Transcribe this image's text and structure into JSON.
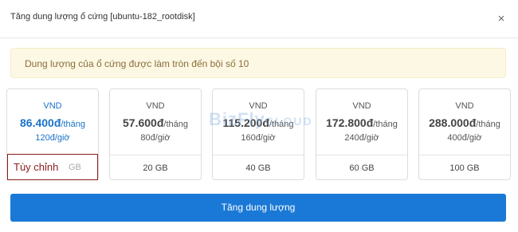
{
  "modal": {
    "title": "Tăng dung lượng ổ cứng [ubuntu-182_rootdisk]",
    "close_glyph": "×",
    "notice": "Dung lượng của ổ cứng được làm tròn đến bội số 10",
    "submit_label": "Tăng dung lượng"
  },
  "currency": "VND",
  "plans": [
    {
      "currency": "VND",
      "price": "86.400đ",
      "unit": "/tháng",
      "hourly": "120đ/giờ",
      "size": "",
      "active": true
    },
    {
      "currency": "VND",
      "price": "57.600đ",
      "unit": "/tháng",
      "hourly": "80đ/giờ",
      "size": "20 GB",
      "active": false
    },
    {
      "currency": "VND",
      "price": "115.200đ",
      "unit": "/tháng",
      "hourly": "160đ/giờ",
      "size": "40 GB",
      "active": false
    },
    {
      "currency": "VND",
      "price": "172.800đ",
      "unit": "/tháng",
      "hourly": "240đ/giờ",
      "size": "60 GB",
      "active": false
    },
    {
      "currency": "VND",
      "price": "288.000đ",
      "unit": "/tháng",
      "hourly": "400đ/giờ",
      "size": "100 GB",
      "active": false
    }
  ],
  "custom": {
    "label": "Tùy chỉnh",
    "placeholder": "GB"
  },
  "watermark": {
    "brand": "BizFly",
    "suffix": "CLOUD"
  },
  "colors": {
    "accent": "#1a79d6",
    "active_text": "#1a73c9",
    "notice_bg": "#fcf8e3",
    "notice_text": "#8a6d3b",
    "highlight_border": "#8b1c1c"
  }
}
